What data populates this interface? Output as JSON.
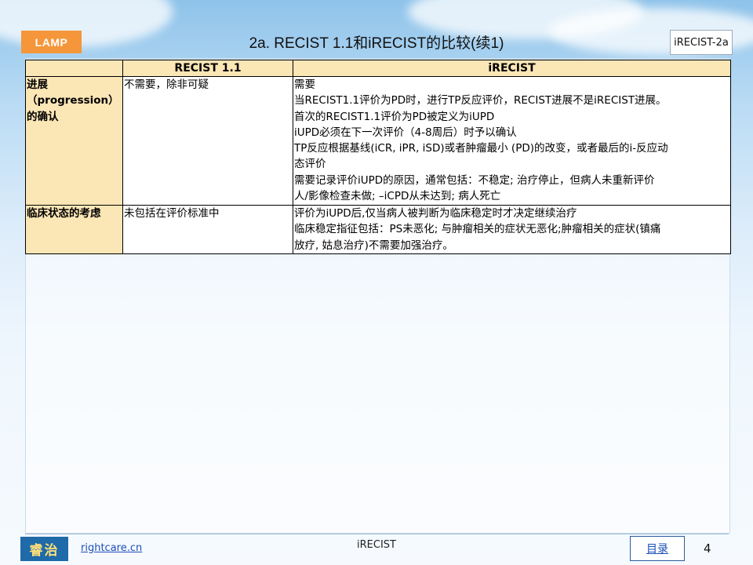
{
  "header": {
    "brand": "LAMP",
    "title": "2a. RECIST 1.1和iRECIST的比较(续1)",
    "tag": "iRECIST-2a"
  },
  "table": {
    "columns": [
      "",
      "RECIST 1.1",
      "iRECIST"
    ],
    "rows": [
      {
        "head_lines": [
          "进展",
          "（progression）",
          "的确认"
        ],
        "recist": "不需要，除非可疑",
        "irecist_lines": [
          "需要",
          "当RECIST1.1评价为PD时，进行TP反应评价，RECIST进展不是iRECIST进展。",
          "首次的RECIST1.1评价为PD被定义为iUPD",
          "iUPD必须在下一次评价（4-8周后）时予以确认",
          "TP反应根据基线(iCR, iPR, iSD)或者肿瘤最小 (PD)的改变，或者最后的i-反应动",
          "态评价",
          "需要记录评价iUPD的原因，通常包括：不稳定; 治疗停止，但病人未重新评价",
          "人/影像检查未做; –iCPD从未达到; 病人死亡"
        ]
      },
      {
        "head_lines": [
          "临床状态的考虑"
        ],
        "recist": "未包括在评价标准中",
        "irecist_lines": [
          "评价为iUPD后,仅当病人被判断为临床稳定时才决定继续治疗",
          "临床稳定指征包括：PS未恶化; 与肿瘤相关的症状无恶化;肿瘤相关的症状(镇痛",
          "放疗, 姑息治疗)不需要加强治疗。"
        ]
      }
    ]
  },
  "footer": {
    "logo_text": "睿治",
    "site": "rightcare.cn",
    "center": "iRECIST",
    "toc": "目录",
    "page": "4"
  }
}
